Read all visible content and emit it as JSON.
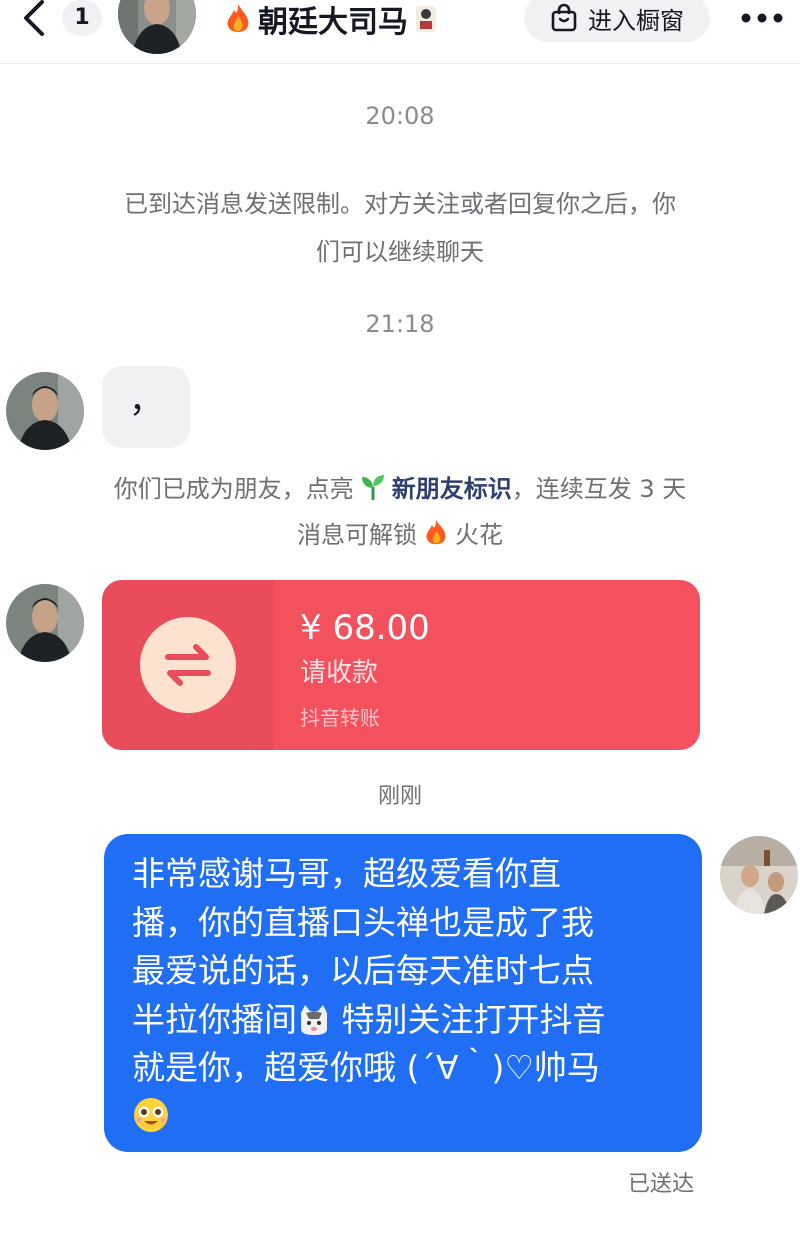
{
  "header": {
    "back_icon": "chevron-left-icon",
    "unread_count": "1",
    "title": "朝廷大司马",
    "shop_label": "进入橱窗",
    "more_icon": "more-dots-icon"
  },
  "chat": {
    "time_1": "20:08",
    "system_limit_line_1": "已到达消息发送限制。对方关注或者回复你之后，你",
    "system_limit_line_2": "们可以继续聊天",
    "time_2": "21:18",
    "incoming_message": "，",
    "friend_notice": {
      "prefix": "你们已成为朋友，点亮",
      "badge_label": "新朋友标识",
      "suffix": "，连续互发 3 天",
      "line2_prefix": "消息可解锁",
      "spark_label": "火花"
    },
    "transfer": {
      "amount": "¥ 68.00",
      "status": "请收款",
      "source": "抖音转账",
      "icon": "transfer-arrows-icon"
    },
    "just_now": "刚刚",
    "outgoing_message": {
      "line_1": "非常感谢马哥，超级爱看你直",
      "line_2": "播，你的直播口头禅也是成了我",
      "line_3": "最爱说的话，以后每天准时七点",
      "line_4_prefix": "半拉你播间",
      "line_4_suffix": " 特别关注打开抖音",
      "line_5": "就是你，超爱你哦 (´∀｀)♡帅马"
    },
    "delivered": "已送达"
  },
  "colors": {
    "outgoing_bubble": "#1f6ef4",
    "transfer_card": "#f4515f",
    "incoming_bubble": "#f1f1f3"
  }
}
